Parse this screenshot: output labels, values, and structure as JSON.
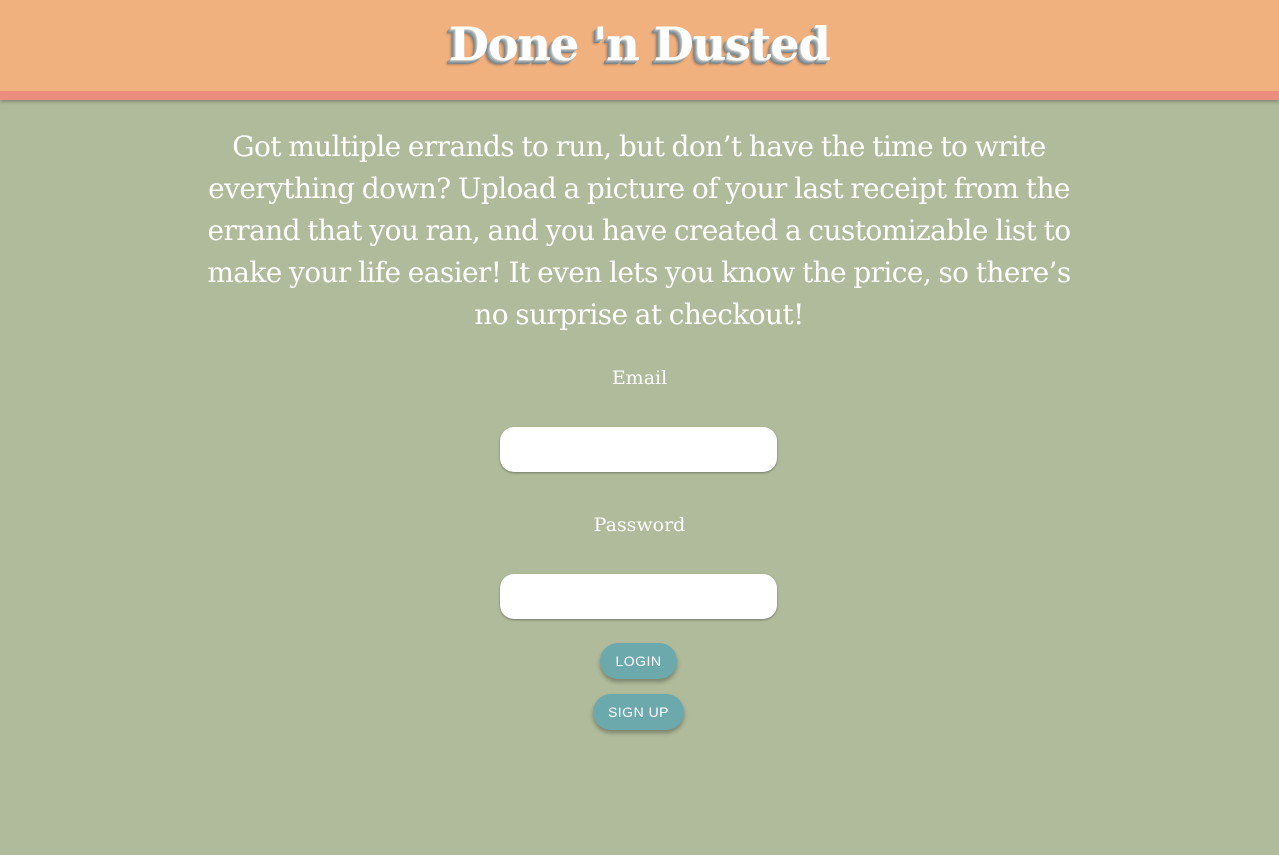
{
  "header": {
    "title": "Done 'n Dusted"
  },
  "intro": {
    "text": "Got multiple errands to run, but don’t have the time to write everything down? Upload a picture of your last receipt from the errand that you ran, and you have created a customizable list to make your life easier! It even lets you know the price, so there’s no surprise at checkout!"
  },
  "login_form": {
    "email_label": "Email",
    "email_value": "",
    "password_label": "Password",
    "password_value": "",
    "login_label": "Login",
    "signup_label": "Sign Up"
  },
  "colors": {
    "header_bg": "#f1b17f",
    "header_border": "#ec8e7d",
    "page_bg": "#b0bb9b",
    "button_bg": "#6ba9ad",
    "text": "#ffffff"
  }
}
